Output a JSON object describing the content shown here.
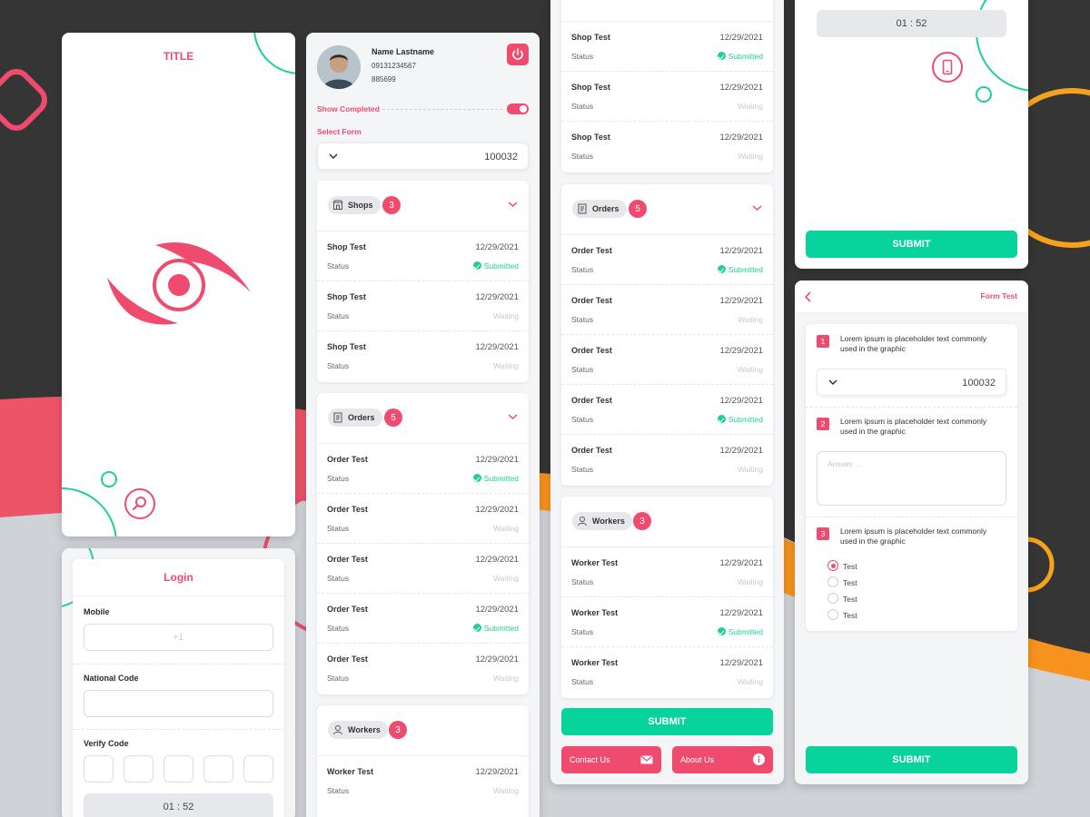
{
  "colors": {
    "accent": "#ee4b6e",
    "green": "#08d39c",
    "dark": "#333333",
    "orange": "#f7921d"
  },
  "splash": {
    "title": "TITLE",
    "logo_icon": "eye-logo",
    "search_icon": "search-icon"
  },
  "login": {
    "heading": "Login",
    "mobile_label": "Mobile",
    "mobile_placeholder": "+1",
    "national_label": "National Code",
    "verify_label": "Verify Code",
    "timer": "01 : 52"
  },
  "profile": {
    "name": "Name Lastname",
    "phone": "09131234567",
    "id": "885699",
    "power_icon": "power-icon",
    "show_completed": "Show Completed",
    "select_form_label": "Select Form",
    "select_value": "100032"
  },
  "col2": {
    "shops": {
      "label": "Shops",
      "count": "3",
      "items": [
        {
          "title": "Shop Test",
          "date": "12/29/2021",
          "label": "Status",
          "status": "Submitted",
          "ok": true
        },
        {
          "title": "Shop Test",
          "date": "12/29/2021",
          "label": "Status",
          "status": "Waiting",
          "ok": false
        },
        {
          "title": "Shop Test",
          "date": "12/29/2021",
          "label": "Status",
          "status": "Waiting",
          "ok": false
        }
      ]
    },
    "orders": {
      "label": "Orders",
      "count": "5",
      "items": [
        {
          "title": "Order Test",
          "date": "12/29/2021",
          "label": "Status",
          "status": "Submitted",
          "ok": true
        },
        {
          "title": "Order Test",
          "date": "12/29/2021",
          "label": "Status",
          "status": "Waiting",
          "ok": false
        },
        {
          "title": "Order Test",
          "date": "12/29/2021",
          "label": "Status",
          "status": "Waiting",
          "ok": false
        },
        {
          "title": "Order Test",
          "date": "12/29/2021",
          "label": "Status",
          "status": "Submitted",
          "ok": true
        },
        {
          "title": "Order Test",
          "date": "12/29/2021",
          "label": "Status",
          "status": "Waiting",
          "ok": false
        }
      ]
    },
    "workers": {
      "label": "Workers",
      "count": "3",
      "items": [
        {
          "title": "Worker Test",
          "date": "12/29/2021",
          "label": "Status",
          "status": "Waiting",
          "ok": false
        }
      ]
    }
  },
  "col3": {
    "shops_items": [
      {
        "title": "Shop Test",
        "date": "12/29/2021",
        "label": "Status",
        "status": "Submitted",
        "ok": true
      },
      {
        "title": "Shop Test",
        "date": "12/29/2021",
        "label": "Status",
        "status": "Waiting",
        "ok": false
      },
      {
        "title": "Shop Test",
        "date": "12/29/2021",
        "label": "Status",
        "status": "Waiting",
        "ok": false
      }
    ],
    "orders": {
      "label": "Orders",
      "count": "5",
      "items": [
        {
          "title": "Order Test",
          "date": "12/29/2021",
          "label": "Status",
          "status": "Submitted",
          "ok": true
        },
        {
          "title": "Order Test",
          "date": "12/29/2021",
          "label": "Status",
          "status": "Waiting",
          "ok": false
        },
        {
          "title": "Order Test",
          "date": "12/29/2021",
          "label": "Status",
          "status": "Waiting",
          "ok": false
        },
        {
          "title": "Order Test",
          "date": "12/29/2021",
          "label": "Status",
          "status": "Submitted",
          "ok": true
        },
        {
          "title": "Order Test",
          "date": "12/29/2021",
          "label": "Status",
          "status": "Waiting",
          "ok": false
        }
      ]
    },
    "workers": {
      "label": "Workers",
      "count": "3",
      "items": [
        {
          "title": "Worker Test",
          "date": "12/29/2021",
          "label": "Status",
          "status": "Waiting",
          "ok": false
        },
        {
          "title": "Worker Test",
          "date": "12/29/2021",
          "label": "Status",
          "status": "Submitted",
          "ok": true
        },
        {
          "title": "Worker Test",
          "date": "12/29/2021",
          "label": "Status",
          "status": "Waiting",
          "ok": false
        }
      ]
    },
    "submit": "SUBMIT",
    "contact": "Contact Us",
    "about": "About Us"
  },
  "verify_panel": {
    "timer": "01 : 52",
    "submit": "SUBMIT",
    "phone_icon": "phone-icon"
  },
  "form": {
    "title": "Form Test",
    "q1": {
      "num": "1",
      "text": "Lorem ipsum is placeholder text commonly used in the graphic",
      "value": "100032"
    },
    "q2": {
      "num": "2",
      "text": "Lorem ipsum is placeholder text commonly used in the graphic",
      "placeholder": "Answer ..."
    },
    "q3": {
      "num": "3",
      "text": "Lorem ipsum is placeholder text commonly used in the graphic",
      "options": [
        "Test",
        "Test",
        "Test",
        "Test"
      ],
      "selected": 0
    },
    "submit": "SUBMIT"
  }
}
